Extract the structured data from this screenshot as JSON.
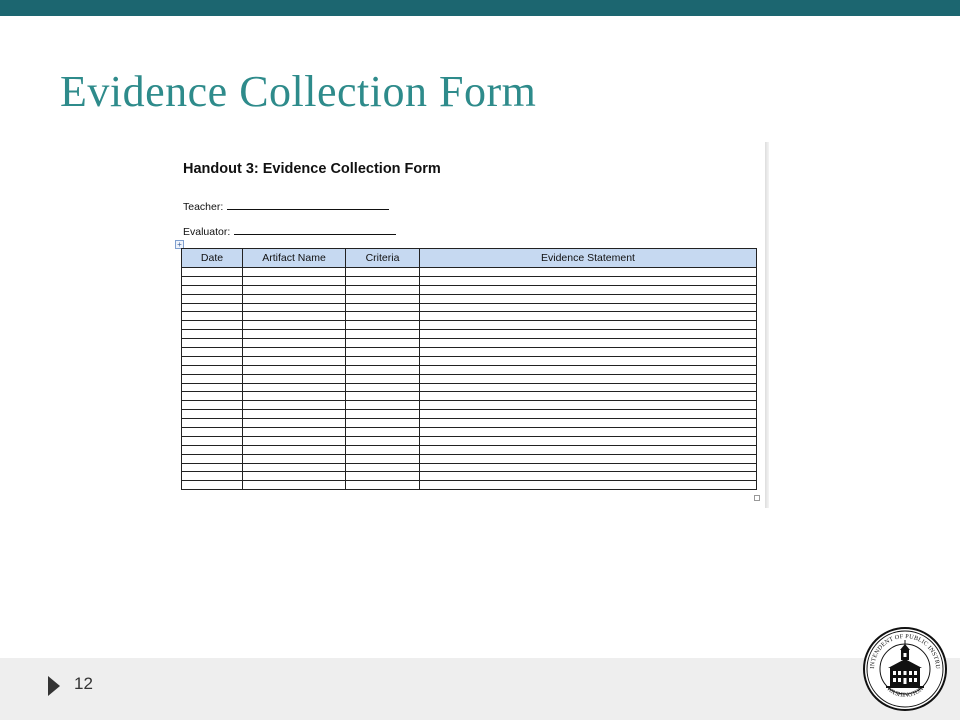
{
  "slide": {
    "title": "Evidence Collection Form",
    "number": "12"
  },
  "handout": {
    "title": "Handout 3: Evidence Collection Form",
    "teacher_label": "Teacher:",
    "evaluator_label": "Evaluator:",
    "table": {
      "columns": [
        "Date",
        "Artifact Name",
        "Criteria",
        "Evidence Statement"
      ],
      "rows": [
        [
          "",
          "",
          "",
          ""
        ],
        [
          "",
          "",
          "",
          ""
        ],
        [
          "",
          "",
          "",
          ""
        ],
        [
          "",
          "",
          "",
          ""
        ],
        [
          "",
          "",
          "",
          ""
        ],
        [
          "",
          "",
          "",
          ""
        ],
        [
          "",
          "",
          "",
          ""
        ],
        [
          "",
          "",
          "",
          ""
        ],
        [
          "",
          "",
          "",
          ""
        ],
        [
          "",
          "",
          "",
          ""
        ],
        [
          "",
          "",
          "",
          ""
        ],
        [
          "",
          "",
          "",
          ""
        ],
        [
          "",
          "",
          "",
          ""
        ],
        [
          "",
          "",
          "",
          ""
        ],
        [
          "",
          "",
          "",
          ""
        ],
        [
          "",
          "",
          "",
          ""
        ],
        [
          "",
          "",
          "",
          ""
        ],
        [
          "",
          "",
          "",
          ""
        ],
        [
          "",
          "",
          "",
          ""
        ],
        [
          "",
          "",
          "",
          ""
        ],
        [
          "",
          "",
          "",
          ""
        ],
        [
          "",
          "",
          "",
          ""
        ],
        [
          "",
          "",
          "",
          ""
        ],
        [
          "",
          "",
          "",
          ""
        ],
        [
          "",
          "",
          "",
          ""
        ]
      ]
    }
  },
  "seal": {
    "text_top": "SUPERINTENDENT OF PUBLIC INSTRUCTION",
    "text_bottom": "WASHINGTON",
    "icon": "capitol-building-seal"
  },
  "colors": {
    "top_bar": "#1c6670",
    "title": "#2e8b8b",
    "table_header": "#c6d9f1",
    "footer": "#eeeeee"
  }
}
